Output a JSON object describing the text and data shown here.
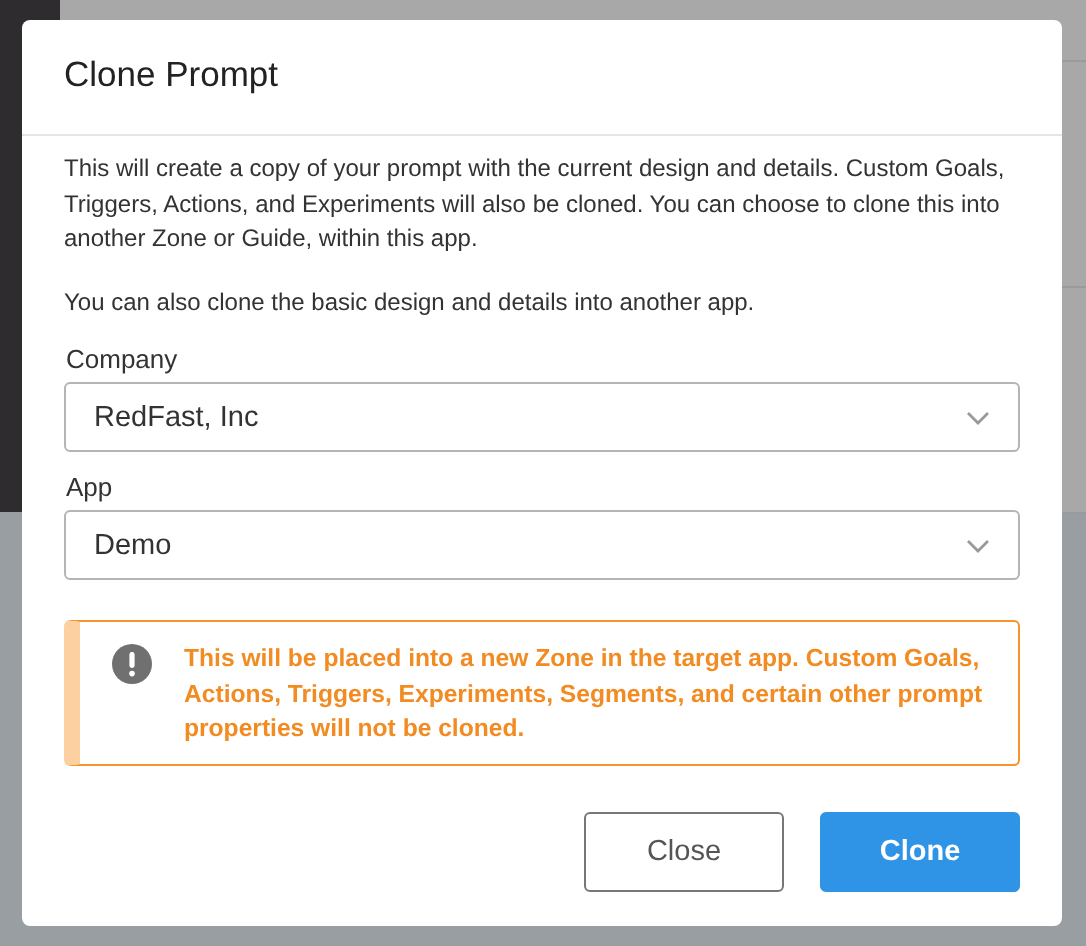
{
  "dialog": {
    "title": "Clone Prompt",
    "paragraphs": [
      "This will create a copy of your prompt with the current design and details. Custom Goals, Triggers, Actions, and Experiments will also be cloned. You can choose to clone this into another Zone or Guide, within this app.",
      "You can also clone the basic design and details into another app."
    ],
    "fields": [
      {
        "label": "Company",
        "value": "RedFast, Inc"
      },
      {
        "label": "App",
        "value": "Demo"
      }
    ],
    "alert": {
      "text": "This will be placed into a new Zone in the target app. Custom Goals, Actions, Triggers, Experiments, Segments, and certain other prompt properties will not be cloned."
    },
    "buttons": [
      {
        "label": "Close",
        "kind": "secondary"
      },
      {
        "label": "Clone",
        "kind": "primary"
      }
    ]
  }
}
